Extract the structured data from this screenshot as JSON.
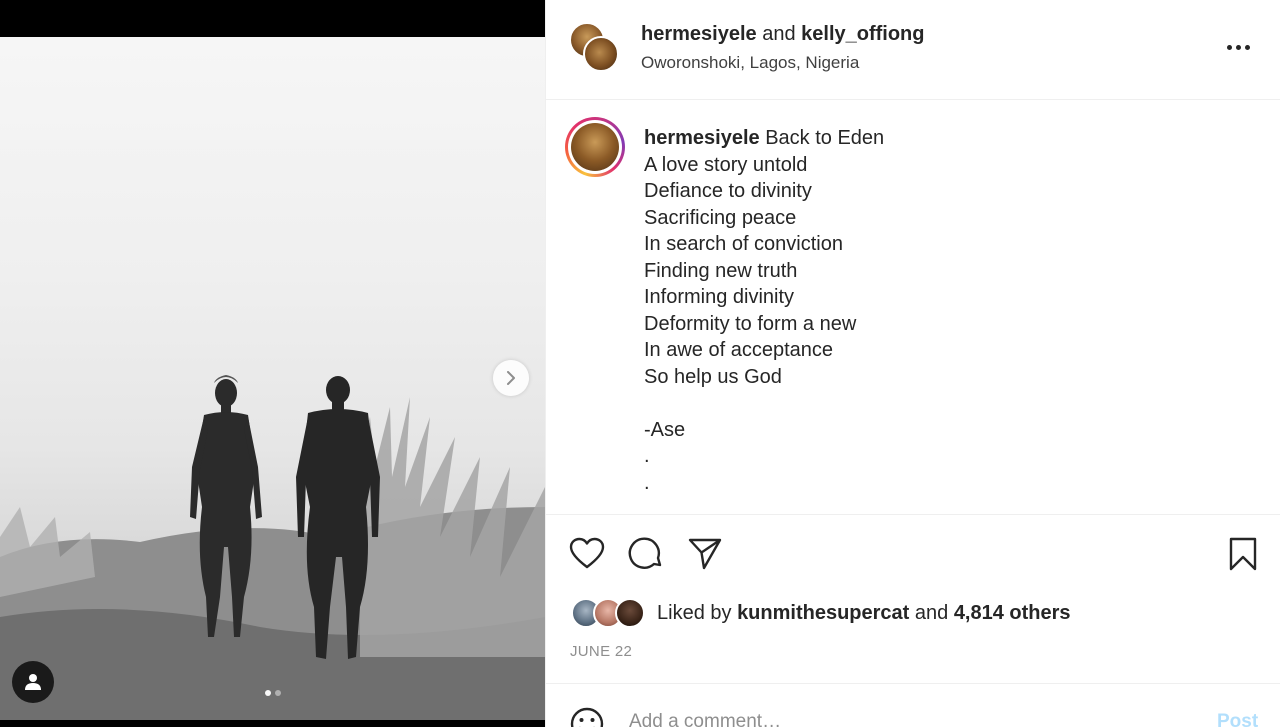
{
  "post": {
    "header": {
      "user1": "hermesiyele",
      "joiner": "and",
      "user2": "kelly_offiong",
      "location": "Oworonshoki, Lagos, Nigeria"
    },
    "caption": {
      "username": "hermesiyele",
      "first_line": " Back to Eden",
      "lines": [
        "A love story untold",
        "Defiance to divinity",
        "Sacrificing peace",
        "In search of conviction",
        "Finding new truth",
        "Informing divinity",
        "Deformity to form a new",
        "In awe of acceptance",
        "So help us God",
        "",
        "-Ase",
        ".",
        "."
      ]
    },
    "likes": {
      "prefix": "Liked by ",
      "user": "kunmithesupercat",
      "middle": " and ",
      "count": "4,814 others"
    },
    "date": "JUNE 22",
    "comment": {
      "placeholder": "Add a comment…",
      "post_label": "Post"
    },
    "carousel": {
      "count": 2,
      "active_index": 0
    }
  },
  "icons": {
    "next": "chevron-right-icon",
    "tag": "user-tag-icon",
    "more": "more-options-icon",
    "like": "heart-icon",
    "comment": "comment-icon",
    "share": "send-icon",
    "save": "bookmark-icon",
    "emoji": "emoji-icon"
  },
  "colors": {
    "text": "#262626",
    "muted": "#8e8e8e",
    "post_disabled": "#b2dffc",
    "border": "#efefef"
  }
}
